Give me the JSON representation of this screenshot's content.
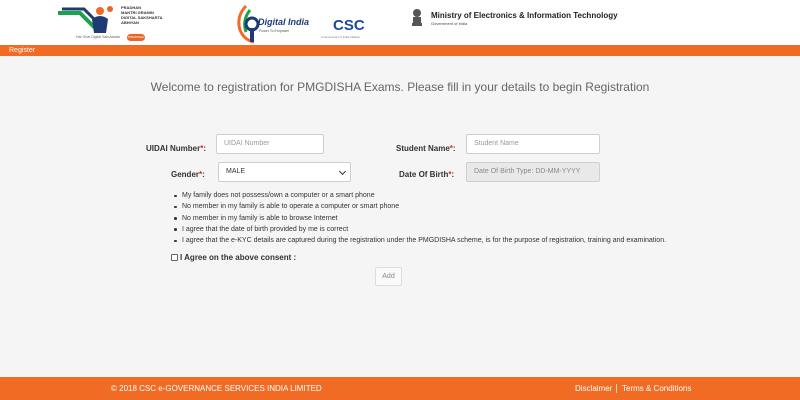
{
  "header": {
    "pmgdisha_logo": {
      "lines": [
        "PRADHAN",
        "MANTRI GRAMIN",
        "DIGITAL SAKSHARTA",
        "ABHIYAN"
      ],
      "tagline": "Har Ghar Digital Saksharata",
      "badge": "PMGDISHA"
    },
    "digital_india": {
      "title": "Digital India",
      "subtitle": "Power To Empower"
    },
    "csc": {
      "title": "CSC",
      "subtitle": "A Government of India Initiative"
    },
    "ministry": {
      "title": "Ministry of Electronics & Information Technology",
      "subtitle": "Government of India"
    }
  },
  "register_bar": {
    "label": "Register"
  },
  "welcome_text": "Welcome to registration for PMGDISHA Exams. Please fill in your details to begin Registration",
  "form": {
    "uidai": {
      "label": "UIDAI Number",
      "required_marker": "*",
      "suffix": ":",
      "placeholder": "UIDAI Number"
    },
    "student_name": {
      "label": "Student Name",
      "required_marker": "*",
      "suffix": ":",
      "placeholder": "Student Name"
    },
    "gender": {
      "label": "Gender",
      "required_marker": "*",
      "suffix": ":",
      "selected": "MALE",
      "options": [
        "MALE"
      ]
    },
    "dob": {
      "label": "Date Of Birth",
      "required_marker": "*",
      "suffix": ":",
      "placeholder": "Date Of Birth Type: DD-MM-YYYY"
    }
  },
  "consent_items": [
    "My family does not possess/own a computer or a smart phone",
    "No member in my family is able to operate a computer or smart phone",
    "No member in my family is able to browse Internet",
    "I agree that the date of birth provided by me is correct",
    "I agree that the e-KYC details are captured during the registration under the PMGDISHA scheme, is for the purpose of registration, training and examination."
  ],
  "agree_label": "I Agree on the above consent :",
  "add_button": "Add",
  "footer": {
    "copyright": "© 2018 CSC e-GOVERNANCE SERVICES INDIA LIMITED",
    "links": [
      "Disclaimer",
      "Terms & Conditions"
    ]
  },
  "colors": {
    "accent": "#f26b25",
    "required": "#e02020",
    "background": "#f5f5f5"
  }
}
